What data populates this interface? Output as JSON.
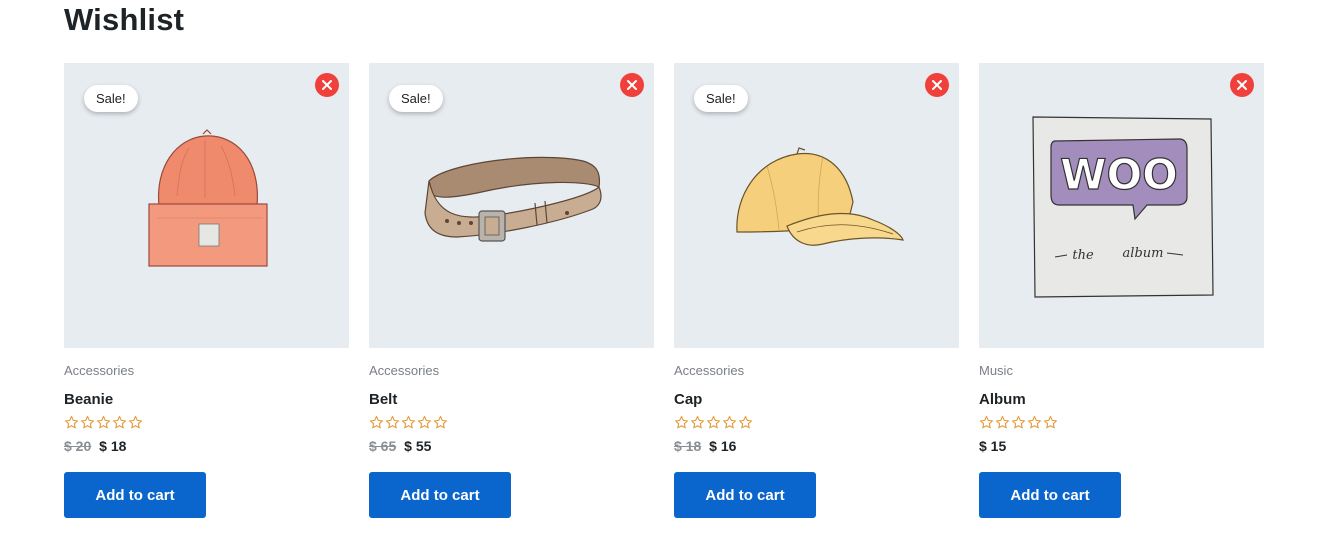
{
  "page": {
    "title": "Wishlist"
  },
  "colors": {
    "accent": "#0a65cc",
    "remove": "#f0403c",
    "star": "#e59a3a",
    "thumb_bg": "#e7ecf1"
  },
  "products": [
    {
      "name": "Beanie",
      "category": "Accessories",
      "badge": "Sale!",
      "old_price": "$ 20",
      "price": "$ 18",
      "rating": 0,
      "button": "Add to cart",
      "image": "beanie-illustration"
    },
    {
      "name": "Belt",
      "category": "Accessories",
      "badge": "Sale!",
      "old_price": "$ 65",
      "price": "$ 55",
      "rating": 0,
      "button": "Add to cart",
      "image": "belt-illustration"
    },
    {
      "name": "Cap",
      "category": "Accessories",
      "badge": "Sale!",
      "old_price": "$ 18",
      "price": "$ 16",
      "rating": 0,
      "button": "Add to cart",
      "image": "cap-illustration"
    },
    {
      "name": "Album",
      "category": "Music",
      "badge": "",
      "old_price": "",
      "price": "$ 15",
      "rating": 0,
      "button": "Add to cart",
      "image": "album-illustration",
      "album_text": {
        "logo": "WOO",
        "caption_left": "the",
        "caption_right": "album"
      }
    }
  ]
}
